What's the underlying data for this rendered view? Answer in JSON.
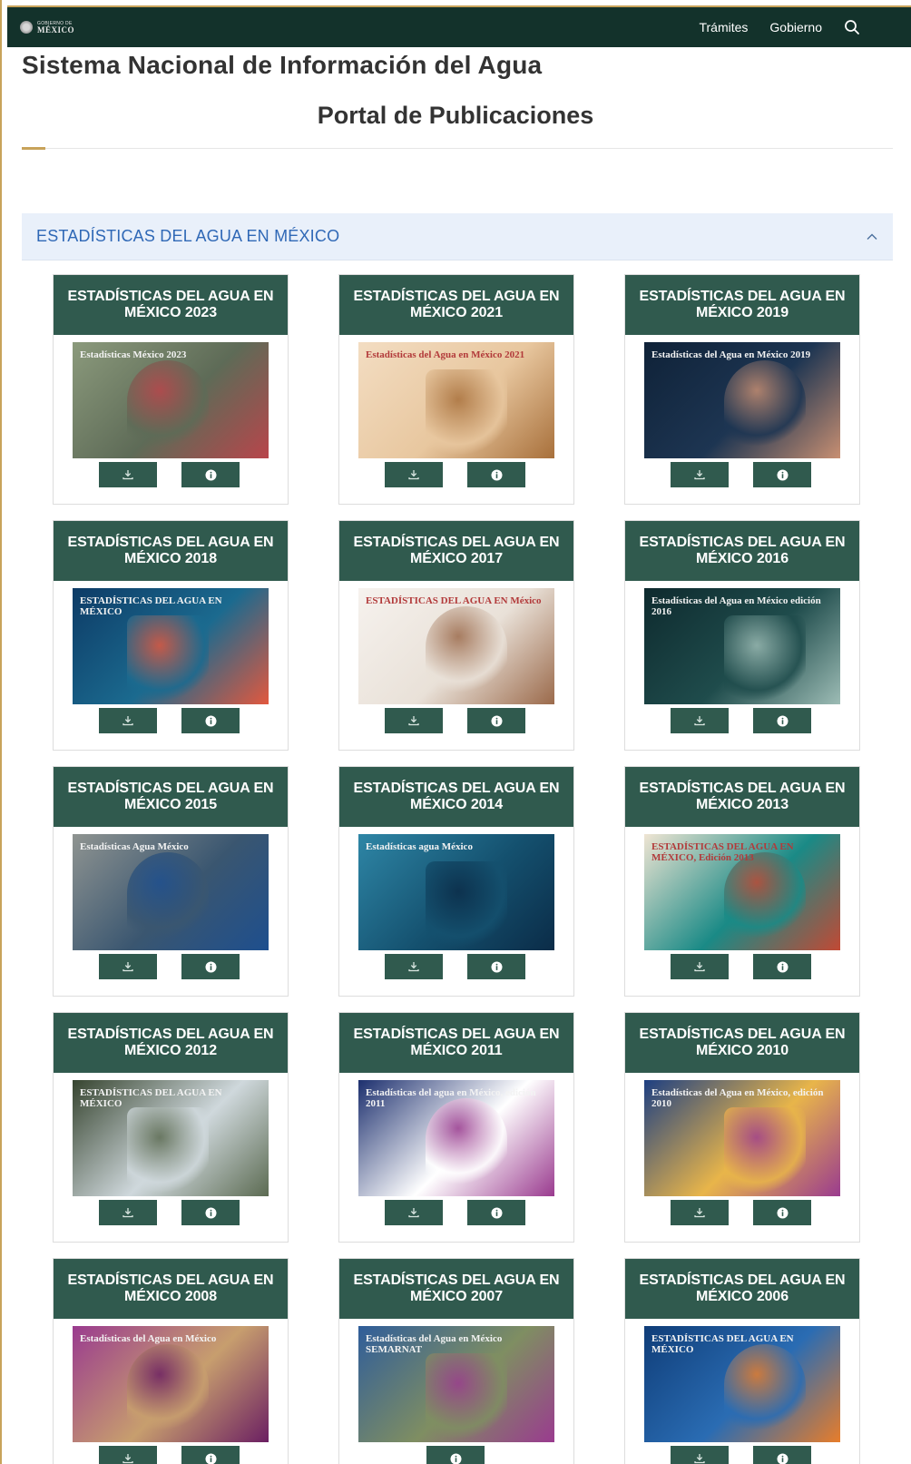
{
  "header": {
    "logo_small": "GOBIERNO DE",
    "logo_big": "MÉXICO",
    "nav": [
      "Trámites",
      "Gobierno"
    ],
    "search_icon": "search-icon"
  },
  "page": {
    "title": "Sistema Nacional de Información del Agua",
    "subtitle": "Portal de Publicaciones"
  },
  "accordion": {
    "title": "ESTADÍSTICAS DEL AGUA EN MÉXICO",
    "state": "expanded",
    "icon": "chevron-up-icon"
  },
  "colors": {
    "topbar": "#13322b",
    "accent_gold": "#c8a35a",
    "card_green": "#305a4e",
    "accordion_bg": "#e9f0fa",
    "accordion_text": "#2f68b6"
  },
  "publications": [
    {
      "title": "ESTADÍSTICAS DEL AGUA EN MÉXICO 2023",
      "cover_text": "Estadísticas México 2023",
      "cover_colors": [
        "#8b9a7c",
        "#5e6b57",
        "#b8454b"
      ],
      "buttons": [
        "download",
        "info"
      ]
    },
    {
      "title": "ESTADÍSTICAS DEL AGUA EN MÉXICO 2021",
      "cover_text": "Estadísticas del Agua en México 2021",
      "cover_colors": [
        "#f3ddc2",
        "#e8c79f",
        "#a8703b"
      ],
      "buttons": [
        "download",
        "info"
      ]
    },
    {
      "title": "ESTADÍSTICAS DEL AGUA EN MÉXICO 2019",
      "cover_text": "Estadísticas del Agua en México 2019",
      "cover_colors": [
        "#0f2238",
        "#1d3552",
        "#c88f72"
      ],
      "buttons": [
        "download",
        "info"
      ]
    },
    {
      "title": "ESTADÍSTICAS DEL AGUA EN MÉXICO 2018",
      "cover_text": "ESTADÍSTICAS DEL AGUA EN MÉXICO",
      "cover_colors": [
        "#0d3b66",
        "#1b6a8f",
        "#e2583e"
      ],
      "buttons": [
        "download",
        "info"
      ]
    },
    {
      "title": "ESTADÍSTICAS DEL AGUA EN MÉXICO 2017",
      "cover_text": "ESTADÍSTICAS DEL AGUA EN México",
      "cover_colors": [
        "#f6f2ee",
        "#e9e1d8",
        "#9b6a4b"
      ],
      "buttons": [
        "download",
        "info"
      ]
    },
    {
      "title": "ESTADÍSTICAS DEL AGUA EN MÉXICO 2016",
      "cover_text": "Estadísticas del Agua en México edición 2016",
      "cover_colors": [
        "#0e2a2e",
        "#1f4c4c",
        "#9dbcb5"
      ],
      "buttons": [
        "download",
        "info"
      ]
    },
    {
      "title": "ESTADÍSTICAS DEL AGUA EN MÉXICO 2015",
      "cover_text": "Estadísticas Agua México",
      "cover_colors": [
        "#8f9491",
        "#3a5670",
        "#1e4f8e"
      ],
      "buttons": [
        "download",
        "info"
      ]
    },
    {
      "title": "ESTADÍSTICAS DEL AGUA EN MÉXICO 2014",
      "cover_text": "Estadísticas agua México",
      "cover_colors": [
        "#2e86a6",
        "#14506e",
        "#0b2c48"
      ],
      "buttons": [
        "download",
        "info"
      ]
    },
    {
      "title": "ESTADÍSTICAS DEL AGUA EN MÉXICO 2013",
      "cover_text": "ESTADÍSTICAS DEL AGUA EN MÉXICO, Edición 2013",
      "cover_colors": [
        "#efe5d3",
        "#1a8a86",
        "#c24934"
      ],
      "buttons": [
        "download",
        "info"
      ]
    },
    {
      "title": "ESTADÍSTICAS DEL AGUA EN MÉXICO 2012",
      "cover_text": "ESTADÍSTICAS DEL AGUA EN MÉXICO",
      "cover_colors": [
        "#36442f",
        "#cfd8dc",
        "#5c6b52"
      ],
      "buttons": [
        "download",
        "info"
      ]
    },
    {
      "title": "ESTADÍSTICAS DEL AGUA EN MÉXICO 2011",
      "cover_text": "Estadísticas del agua en México, edición 2011",
      "cover_colors": [
        "#1c2f6e",
        "#ffffff",
        "#9a3b8f"
      ],
      "buttons": [
        "download",
        "info"
      ]
    },
    {
      "title": "ESTADÍSTICAS DEL AGUA EN MÉXICO 2010",
      "cover_text": "Estadísticas del Agua en México, edición 2010",
      "cover_colors": [
        "#1d3f82",
        "#e8b54a",
        "#9a3b8f"
      ],
      "buttons": [
        "download",
        "info"
      ]
    },
    {
      "title": "ESTADÍSTICAS DEL AGUA EN MÉXICO 2008",
      "cover_text": "Estadísticas del Agua en México",
      "cover_colors": [
        "#9a3b8f",
        "#c79e6e",
        "#6b1f62"
      ],
      "buttons": [
        "download",
        "info"
      ]
    },
    {
      "title": "ESTADÍSTICAS DEL AGUA EN MÉXICO 2007",
      "cover_text": "Estadísticas del Agua en México SEMARNAT",
      "cover_colors": [
        "#2f5d9a",
        "#7f8e62",
        "#9a3b8f"
      ],
      "buttons": [
        "info"
      ]
    },
    {
      "title": "ESTADÍSTICAS DEL AGUA EN MÉXICO 2006",
      "cover_text": "ESTADÍSTICAS DEL AGUA EN MÉXICO",
      "cover_colors": [
        "#0f3d78",
        "#2a6cb3",
        "#e87d2a"
      ],
      "buttons": [
        "download",
        "info"
      ]
    }
  ]
}
